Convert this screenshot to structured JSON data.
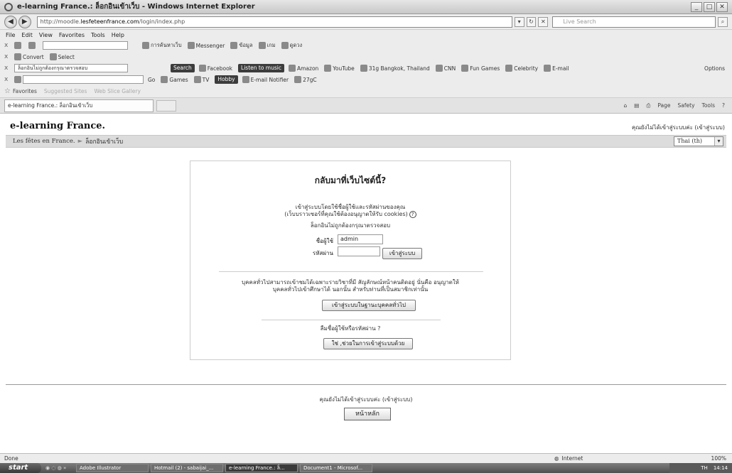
{
  "window": {
    "title": "e-learning France.: ล็อกอินเข้าเว็บ - Windows Internet Explorer"
  },
  "address": {
    "url_prefix": "http://moodle.",
    "url_domain": "lesfeteenfrance.com",
    "url_suffix": "/login/index.php",
    "search_placeholder": "Live Search"
  },
  "menu": [
    "File",
    "Edit",
    "View",
    "Favorites",
    "Tools",
    "Help"
  ],
  "toolbar1": {
    "search_label": "การค้นหาเว็บ",
    "messenger": "Messenger",
    "news": "ข้อมูล",
    "games": "เกม",
    "fortune": "ดูดวง"
  },
  "toolbar2": {
    "convert": "Convert",
    "select": "Select"
  },
  "toolbar3": {
    "search_field": "ล็อกอินไม่ถูกต้องกรุณาตรวจสอบ",
    "search_btn": "Search",
    "facebook": "Facebook",
    "listen": "Listen to music",
    "amazon": "Amazon",
    "youtube": "YouTube",
    "weather": "31g Bangkok, Thailand",
    "cnn": "CNN",
    "fun": "Fun Games",
    "celebrity": "Celebrity",
    "email": "E-mail",
    "options": "Options"
  },
  "toolbar4": {
    "go": "Go",
    "games": "Games",
    "tv": "TV",
    "hobby": "Hobby",
    "notifier": "E-mail Notifier",
    "temp": "27gC"
  },
  "favorites": {
    "label": "Favorites",
    "suggested": "Suggested Sites",
    "webslice": "Web Slice Gallery"
  },
  "tab": {
    "title": "e-learning France.: ล็อกอินเข้าเว็บ"
  },
  "commandbar": [
    "Page",
    "Safety",
    "Tools"
  ],
  "page": {
    "site_title": "e-learning France.",
    "login_state": "คุณยังไม่ได้เข้าสู่ระบบค่ะ (เข้าสู่ระบบ)",
    "breadcrumb_home": "Les fêtes en France.",
    "breadcrumb_sep": "►",
    "breadcrumb_current": "ล็อกอินเข้าเว็บ",
    "language": "Thai (th)",
    "login_heading": "กลับมาที่เว็บไซต์นี้?",
    "login_intro_1": "เข้าสู่ระบบโดยใช้ชื่อผู้ใช้และรหัสผ่านของคุณ",
    "login_intro_2": "(เว็บบราวเซอร์ที่คุณใช้ต้องอนุญาตให้รับ cookies)",
    "error_msg": "ล็อกอินไม่ถูกต้องกรุณาตรวจสอบ",
    "username_label": "ชื่อผู้ใช้",
    "username_value": "admin",
    "password_label": "รหัสผ่าน",
    "login_btn": "เข้าสู่ระบบ",
    "guest_text_1": "บุคคลทั่วไปสามารถเข้าชมได้เฉพาะรายวิชาที่มี สัญลักษณ์หน้าคนติดอยู่ นั่นคือ อนุญาตให้",
    "guest_text_2": "บุคคลทั่วไปเข้าศึกษาได้ นอกนั้น สำหรับท่านที่เป็นสมาชิกเท่านั้น",
    "guest_btn": "เข้าสู่ระบบในฐานะบุคคลทั่วไป",
    "forgot_text": "ลืมชื่อผู้ใช้หรือรหัสผ่าน ?",
    "forgot_btn": "ใช่ ,ช่วยในการเข้าสู่ระบบด้วย",
    "footer_login_state": "คุณยังไม่ได้เข้าสู่ระบบค่ะ (เข้าสู่ระบบ)",
    "home_btn": "หน้าหลัก"
  },
  "status": {
    "left": "Done",
    "zone": "Internet",
    "zoom": "100%"
  },
  "taskbar": {
    "start": "start",
    "items": [
      "Adobe Illustrator",
      "Hotmail (2) - sabaijai_...",
      "e-learning France.: ล็...",
      "Document1 - Microsof..."
    ],
    "lang": "TH",
    "time": "14:14"
  }
}
